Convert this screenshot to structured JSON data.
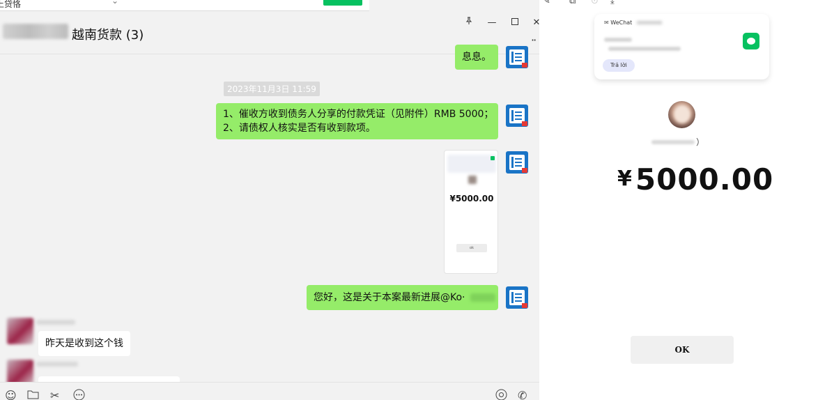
{
  "window": {
    "title": "越南货款 (3)",
    "topstrip_text": "上贷恪",
    "pin_icon": "pin-icon",
    "minimize_icon": "minimize-icon",
    "maximize_icon": "maximize-icon",
    "close_icon": "close-icon"
  },
  "messages": {
    "prev_fragment": "息息。",
    "timestamp": "2023年11月3日 11:59",
    "notice_line1": "1、催收方收到债务人分享的付款凭证（见附件）RMB 5000；",
    "notice_line2": "2、请债权人核实是否有收到款项。",
    "thumb_amount": "¥5000.00",
    "thumb_ok": "ok",
    "latest_text": "您好，这是关于本案最新进展@Ko·",
    "reply_text": "昨天是收到这个钱"
  },
  "preview": {
    "notif_app": "WeChat",
    "notif_reply": "Trả lời",
    "payer_suffix": "）",
    "amount_symbol": "¥",
    "amount_value": "5000.00",
    "ok_label": "OK"
  },
  "colors": {
    "chat_bg": "#f2f2f2",
    "sent_bubble": "#95ec69",
    "received_bubble": "#ffffff",
    "wechat_green": "#07c160",
    "doc_avatar_blue": "#1a74c6"
  }
}
